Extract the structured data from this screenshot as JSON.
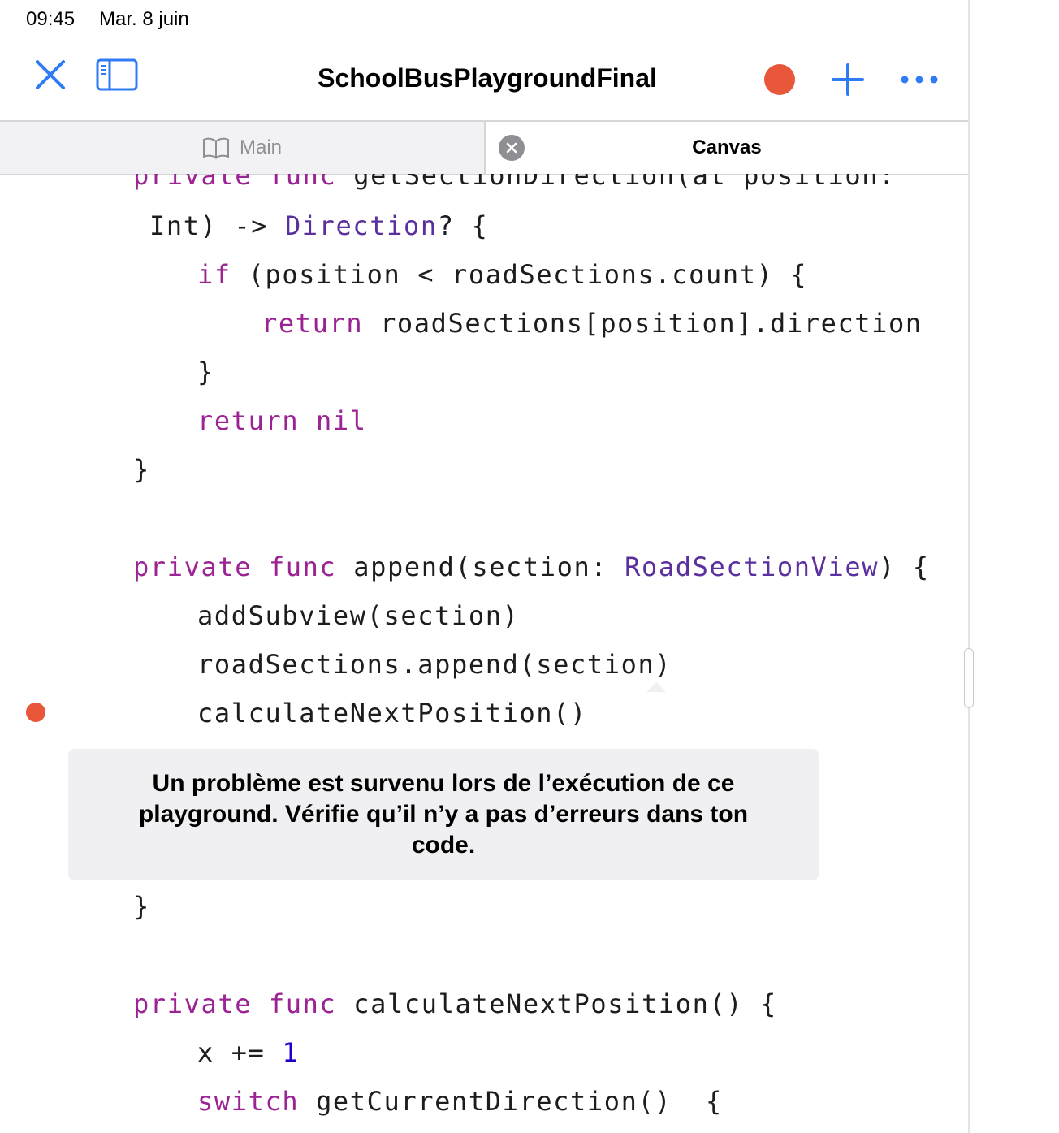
{
  "status_bar": {
    "time": "09:45",
    "date": "Mar. 8 juin"
  },
  "nav": {
    "title": "SchoolBusPlaygroundFinal"
  },
  "tabs": {
    "main_label": "Main",
    "canvas_label": "Canvas"
  },
  "colors": {
    "accent": "#2f7bf6",
    "record": "#e9573a",
    "keyword": "#9b2393",
    "type": "#5a2f9e",
    "number": "#1c00cf"
  },
  "icons": [
    "close-icon",
    "sidebar-icon",
    "record-icon",
    "plus-icon",
    "ellipsis-icon",
    "book-icon",
    "tab-close-icon"
  ],
  "code": {
    "l1_kw1": "private",
    "l1_kw2": "func",
    "l1_txt": " getSectionDirection(at position:",
    "l2_txt1": "Int) -> ",
    "l2_ty": "Direction",
    "l2_txt2": "? {",
    "l3_kw": "if",
    "l3_txt": " (position < roadSections.count) {",
    "l4_kw": "return",
    "l4_txt": " roadSections[position].direction",
    "l5_txt": "}",
    "l6_kw": "return nil",
    "l7_txt": "}",
    "l8_kw1": "private",
    "l8_kw2": "func",
    "l8_txt1": " append(section: ",
    "l8_ty": "RoadSectionView",
    "l8_txt2": ") {",
    "l9_txt": "addSubview(section)",
    "l10_txt": "roadSections.append(section)",
    "l11_txt": "calculateNextPosition()",
    "l12_txt": "}",
    "l13_kw1": "private",
    "l13_kw2": "func",
    "l13_txt": " calculateNextPosition() {",
    "l14_txt": "x += ",
    "l14_num": "1",
    "l15_kw": "switch",
    "l15_txt": " getCurrentDirection()  {"
  },
  "error": {
    "message": "Un problème est survenu lors de l’exécution de ce playground. Vérifie qu’il n’y a pas d’erreurs dans ton code."
  }
}
